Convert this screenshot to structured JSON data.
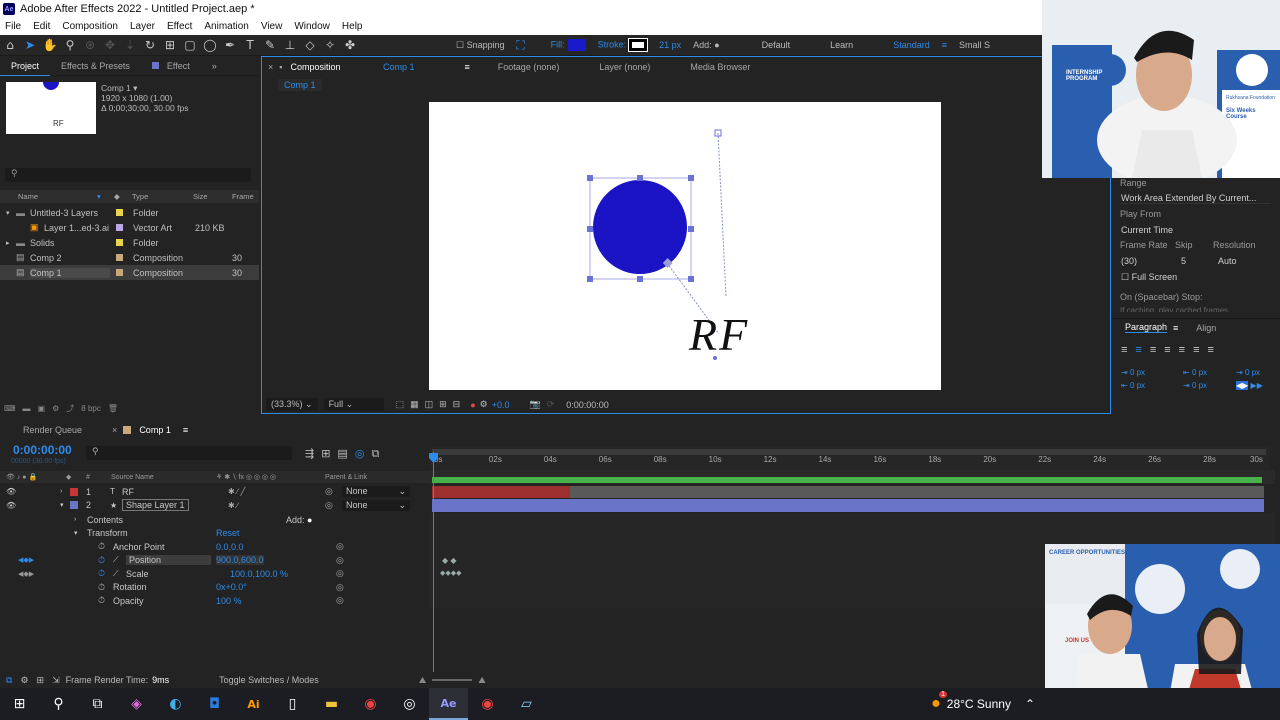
{
  "app": {
    "title": "Adobe After Effects 2022 - Untitled Project.aep *",
    "icon_label": "Ae"
  },
  "menu": [
    "File",
    "Edit",
    "Composition",
    "Layer",
    "Effect",
    "Animation",
    "View",
    "Window",
    "Help"
  ],
  "toolbar": {
    "snapping_label": "Snapping",
    "fill_label": "Fill:",
    "fill_color": "#1a1acd",
    "stroke_label": "Stroke:",
    "stroke_width": "21 px",
    "add_label": "Add:",
    "workspaces": [
      "Default",
      "Learn",
      "Standard",
      "Small S"
    ],
    "active_workspace": "Standard"
  },
  "project_panel": {
    "tabs": [
      "Project",
      "Effects & Presets",
      "Effect"
    ],
    "thumb_text": "RF",
    "comp_name": "Comp 1 ▾",
    "comp_res": "1920 x 1080 (1.00)",
    "comp_dur": "Δ 0;00;30;00, 30.00 fps",
    "columns": [
      "Name",
      "Type",
      "Size",
      "Frame"
    ],
    "items": [
      {
        "name": "Untitled-3 Layers",
        "type": "Folder",
        "size": "",
        "frame": "",
        "color": "#e8d44d"
      },
      {
        "name": "Layer 1...ed-3.ai",
        "type": "Vector Art",
        "size": "210 KB",
        "frame": "",
        "color": "#b9a8e6"
      },
      {
        "name": "Solids",
        "type": "Folder",
        "size": "",
        "frame": "",
        "color": "#e8d44d"
      },
      {
        "name": "Comp 2",
        "type": "Composition",
        "size": "",
        "frame": "30",
        "color": "#c9a87c"
      },
      {
        "name": "Comp 1",
        "type": "Composition",
        "size": "",
        "frame": "30",
        "color": "#c9a87c"
      }
    ],
    "bpc": "8 bpc"
  },
  "comp_panel": {
    "tab_label": "Composition",
    "tab_comp": "Comp 1",
    "footage": "Footage (none)",
    "layer": "Layer (none)",
    "media_browser": "Media Browser",
    "breadcrumb": "Comp 1",
    "canvas_text": "RF",
    "circle_color": "#1a14c4",
    "zoom": "(33.3%)",
    "resolution": "Full",
    "exposure": "+0.0",
    "timecode": "0:00:00:00"
  },
  "preview_panel": {
    "range_label": "Range",
    "range_value": "Work Area Extended By Current...",
    "play_from_label": "Play From",
    "play_from_value": "Current Time",
    "frame_rate_label": "Frame Rate",
    "skip_label": "Skip",
    "resolution_label": "Resolution",
    "frame_rate_value": "(30)",
    "skip_value": "5",
    "resolution_value": "Auto",
    "full_screen_label": "Full Screen",
    "stop_label": "On (Spacebar) Stop:",
    "stop_sub": "If caching, play cached frames"
  },
  "paragraph_panel": {
    "tabs": [
      "Paragraph",
      "Align"
    ],
    "spacing": [
      "0 px",
      "0 px",
      "0 px",
      "0 px",
      "0 px"
    ]
  },
  "timeline": {
    "tabs": [
      "Render Queue",
      "Comp 1"
    ],
    "timecode": "0:00:00:00",
    "fps": "00000 (30.00 fps)",
    "col_source": "Source Name",
    "col_parent": "Parent & Link",
    "ruler": [
      "0s",
      "02s",
      "04s",
      "06s",
      "08s",
      "10s",
      "12s",
      "14s",
      "16s",
      "18s",
      "20s",
      "22s",
      "24s",
      "26s",
      "28s",
      "30s"
    ],
    "layers": [
      {
        "num": "1",
        "type_icon": "T",
        "name": "RF",
        "parent": "None",
        "color": "#c93535"
      },
      {
        "num": "2",
        "type_icon": "★",
        "name": "Shape Layer 1",
        "parent": "None",
        "color": "#6a74c9"
      }
    ],
    "contents_label": "Contents",
    "add_label": "Add:",
    "transform_label": "Transform",
    "reset_label": "Reset",
    "properties": [
      {
        "name": "Anchor Point",
        "value": "0.0,0.0"
      },
      {
        "name": "Position",
        "value": "900.0,600.0"
      },
      {
        "name": "Scale",
        "value": "100.0,100.0 %"
      },
      {
        "name": "Rotation",
        "value": "0x+0.0°"
      },
      {
        "name": "Opacity",
        "value": "100 %"
      }
    ],
    "frame_render_label": "Frame Render Time:",
    "frame_render_value": "9ms",
    "toggle_label": "Toggle Switches / Modes"
  },
  "webcam": {
    "banner1": "INTERNSHIP PROGRAM",
    "banner2": "Rukhsana Foundation",
    "banner3": "Six Weeks Course",
    "banner4": "CAREER OPPORTUNITIES",
    "banner5": "JOIN US"
  },
  "taskbar": {
    "weather": "28°C Sunny",
    "weather_badge": "1",
    "apps": [
      "windows-start",
      "search",
      "task-view",
      "copilot",
      "edge",
      "outlook",
      "illustrator",
      "file",
      "explorer",
      "chrome",
      "obs",
      "after-effects",
      "chrome2",
      "notepad"
    ]
  }
}
